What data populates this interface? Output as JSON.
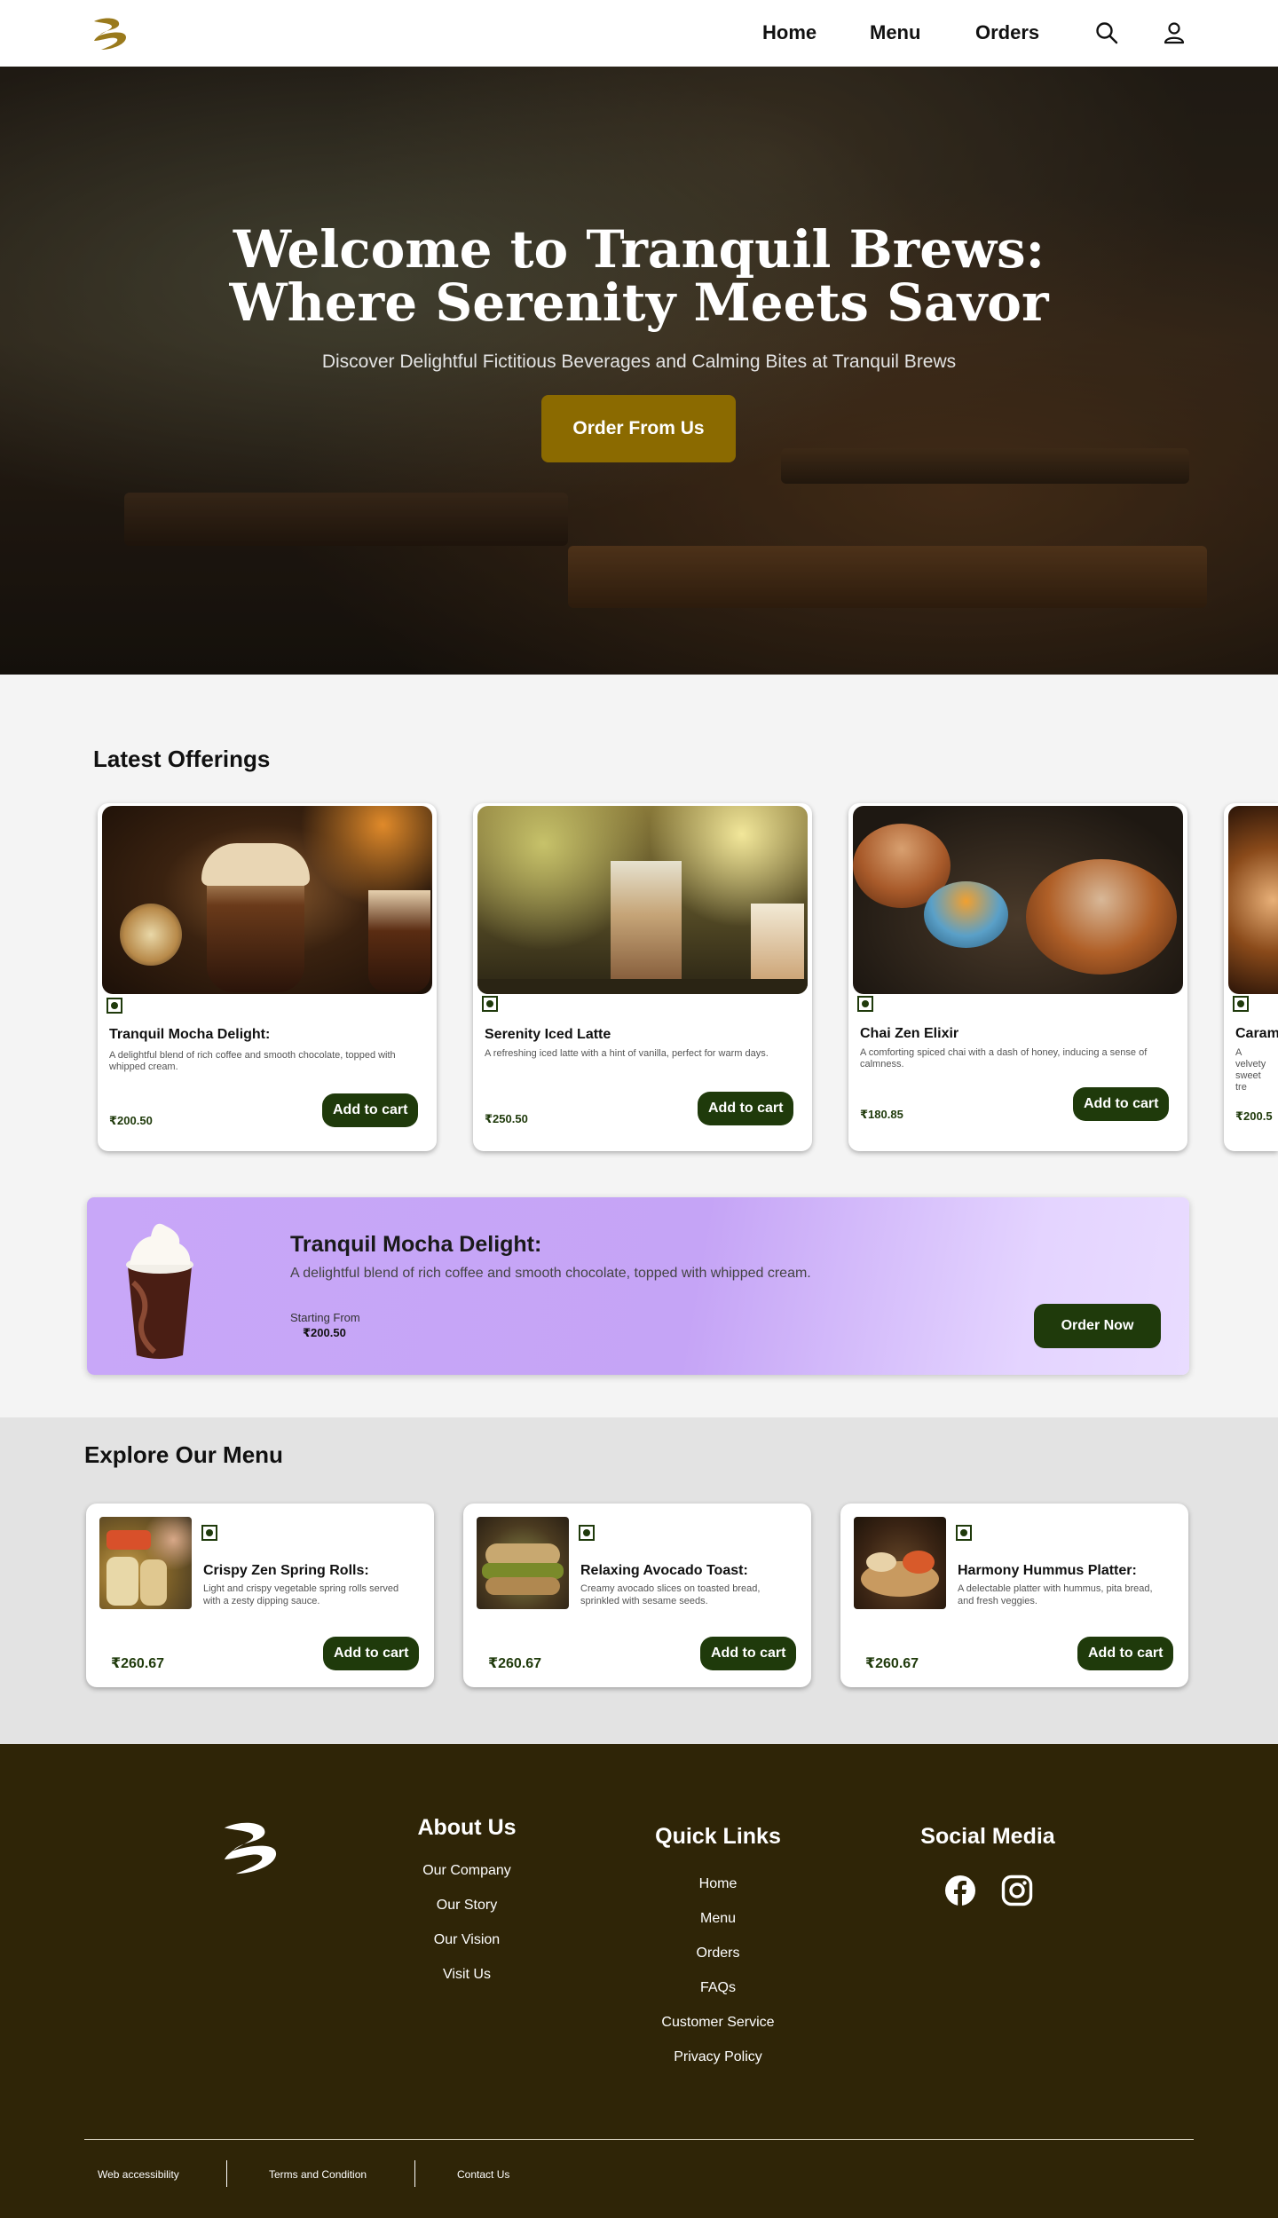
{
  "nav": {
    "links": [
      "Home",
      "Menu",
      "Orders"
    ],
    "icons": [
      "search-icon",
      "user-icon"
    ]
  },
  "hero": {
    "title_line1": "Welcome to Tranquil Brews:",
    "title_line2": "Where Serenity Meets Savor",
    "subtitle": "Discover Delightful Fictitious Beverages and Calming Bites at Tranquil Brews",
    "cta": "Order From Us"
  },
  "latest": {
    "title": "Latest Offerings",
    "cart_label": "Add to cart",
    "items": [
      {
        "name": "Tranquil Mocha Delight:",
        "desc": "A delightful blend of rich coffee and smooth chocolate, topped with whipped cream.",
        "price": "₹200.50"
      },
      {
        "name": "Serenity Iced Latte",
        "desc": "A refreshing iced latte with a hint of vanilla, perfect for warm days.",
        "price": "₹250.50"
      },
      {
        "name": "Chai Zen Elixir",
        "desc": "A comforting spiced chai with a dash of honey, inducing a sense of calmness.",
        "price": "₹180.85"
      },
      {
        "name": "Caram",
        "desc": "A velvety sweet tre",
        "price": "₹200.5"
      }
    ]
  },
  "featured": {
    "title": "Tranquil Mocha Delight:",
    "desc": "A delightful blend of rich coffee and smooth chocolate, topped with whipped cream.",
    "from_label": "Starting From",
    "price": "₹200.50",
    "cta": "Order Now"
  },
  "menu": {
    "title": "Explore Our Menu",
    "cart_label": "Add to cart",
    "items": [
      {
        "name": "Crispy Zen Spring Rolls:",
        "desc": "Light and crispy vegetable spring rolls served with a zesty dipping sauce.",
        "price": "₹260.67"
      },
      {
        "name": "Relaxing Avocado Toast:",
        "desc": "Creamy avocado slices on toasted bread, sprinkled with sesame seeds.",
        "price": "₹260.67"
      },
      {
        "name": "Harmony Hummus Platter:",
        "desc": "A delectable platter with hummus, pita bread, and fresh veggies.",
        "price": "₹260.67"
      }
    ]
  },
  "footer": {
    "about": {
      "title": "About Us",
      "links": [
        "Our Company",
        "Our Story",
        "Our Vision",
        "Visit Us"
      ]
    },
    "quick": {
      "title": "Quick Links",
      "links": [
        "Home",
        "Menu",
        "Orders",
        "FAQs",
        "Customer Service",
        "Privacy Policy"
      ]
    },
    "social": {
      "title": "Social Media",
      "icons": [
        "facebook-icon",
        "instagram-icon"
      ]
    },
    "legal": [
      "Web accessibility",
      "Terms and Condition",
      "Contact Us"
    ]
  },
  "colors": {
    "brand_gold": "#8b6a00",
    "button_green": "#1f3a0b",
    "footer_brown": "#2f2507",
    "banner_lavender": "#c8a7f8"
  }
}
